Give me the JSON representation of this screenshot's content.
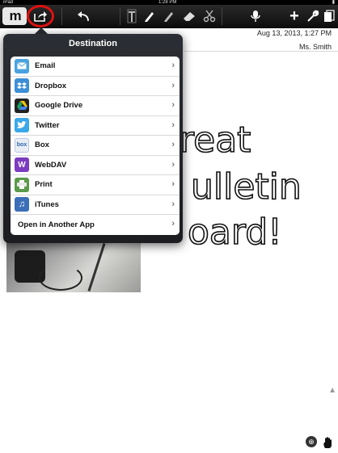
{
  "status_bar": {
    "carrier": "iPad",
    "time": "1:28 PM"
  },
  "toolbar": {
    "logo_label": "m",
    "icons": [
      "share-icon",
      "undo-icon",
      "text-tool-icon",
      "pen-icon",
      "highlighter-icon",
      "eraser-icon",
      "scissors-icon",
      "microphone-icon",
      "add-icon",
      "wrench-icon",
      "pages-icon"
    ]
  },
  "page": {
    "date": "Aug 13, 2013, 1:27 PM",
    "author": "Ms. Smith",
    "handwriting": [
      "reat",
      "ulletin",
      "oard!"
    ]
  },
  "popover": {
    "title": "Destination",
    "items": [
      {
        "label": "Email",
        "icon": "mail-icon",
        "color": "#4aa3df"
      },
      {
        "label": "Dropbox",
        "icon": "dropbox-icon",
        "color": "#3d8fd6"
      },
      {
        "label": "Google Drive",
        "icon": "google-drive-icon",
        "color": "#222222"
      },
      {
        "label": "Twitter",
        "icon": "twitter-icon",
        "color": "#3aa8e8"
      },
      {
        "label": "Box",
        "icon": "box-icon",
        "color": "#e9eef6"
      },
      {
        "label": "WebDAV",
        "icon": "webdav-icon",
        "color": "#7c3bc0"
      },
      {
        "label": "Print",
        "icon": "print-icon",
        "color": "#5a9a4a"
      },
      {
        "label": "iTunes",
        "icon": "itunes-icon",
        "color": "#3b6fb8"
      },
      {
        "label": "Open in Another App",
        "icon": "",
        "color": ""
      }
    ]
  },
  "colors": {
    "highlight_ring": "#e01010",
    "toolbar_bg": "#111111"
  }
}
